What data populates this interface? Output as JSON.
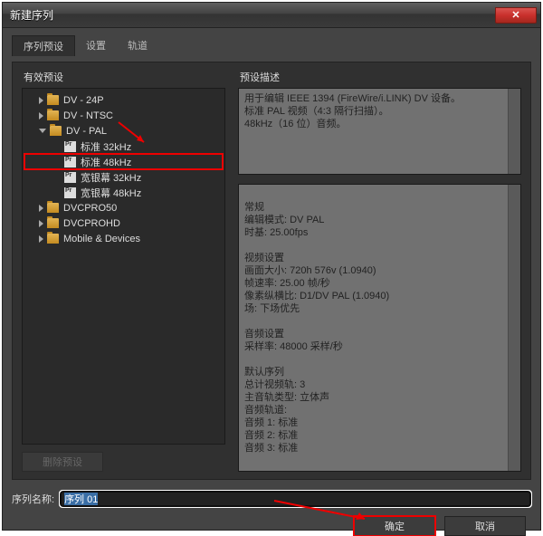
{
  "window": {
    "title": "新建序列",
    "close_glyph": "✕"
  },
  "tabs": [
    {
      "label": "序列预设",
      "active": true
    },
    {
      "label": "设置",
      "active": false
    },
    {
      "label": "轨道",
      "active": false
    }
  ],
  "left": {
    "header": "有效预设",
    "tree": [
      {
        "type": "folder",
        "state": "closed",
        "indent": 1,
        "label": "DV - 24P"
      },
      {
        "type": "folder",
        "state": "closed",
        "indent": 1,
        "label": "DV - NTSC"
      },
      {
        "type": "folder",
        "state": "open",
        "indent": 1,
        "label": "DV - PAL"
      },
      {
        "type": "preset",
        "state": "none",
        "indent": 2,
        "label": "标准 32kHz"
      },
      {
        "type": "preset",
        "state": "none",
        "indent": 2,
        "label": "标准 48kHz",
        "hl": true
      },
      {
        "type": "preset",
        "state": "none",
        "indent": 2,
        "label": "宽银幕 32kHz"
      },
      {
        "type": "preset",
        "state": "none",
        "indent": 2,
        "label": "宽银幕 48kHz"
      },
      {
        "type": "folder",
        "state": "closed",
        "indent": 1,
        "label": "DVCPRO50"
      },
      {
        "type": "folder",
        "state": "closed",
        "indent": 1,
        "label": "DVCPROHD"
      },
      {
        "type": "folder",
        "state": "closed",
        "indent": 1,
        "label": "Mobile & Devices"
      }
    ],
    "delete_label": "删除预设"
  },
  "right": {
    "header": "预设描述",
    "desc_top": "用于编辑 IEEE 1394 (FireWire/i.LINK) DV 设备。\n标准 PAL 视频（4:3 隔行扫描）。\n48kHz（16 位）音频。",
    "desc_bottom": "常规\n编辑模式: DV PAL\n时基: 25.00fps\n\n视频设置\n画面大小: 720h 576v (1.0940)\n帧速率: 25.00 帧/秒\n像素纵横比: D1/DV PAL (1.0940)\n场: 下场优先\n\n音频设置\n采样率: 48000 采样/秒\n\n默认序列\n总计视频轨: 3\n主音轨类型: 立体声\n音频轨道:\n音频 1: 标准\n音频 2: 标准\n音频 3: 标准"
  },
  "footer": {
    "name_label": "序列名称:",
    "name_value": "序列 01",
    "ok_label": "确定",
    "cancel_label": "取消"
  }
}
